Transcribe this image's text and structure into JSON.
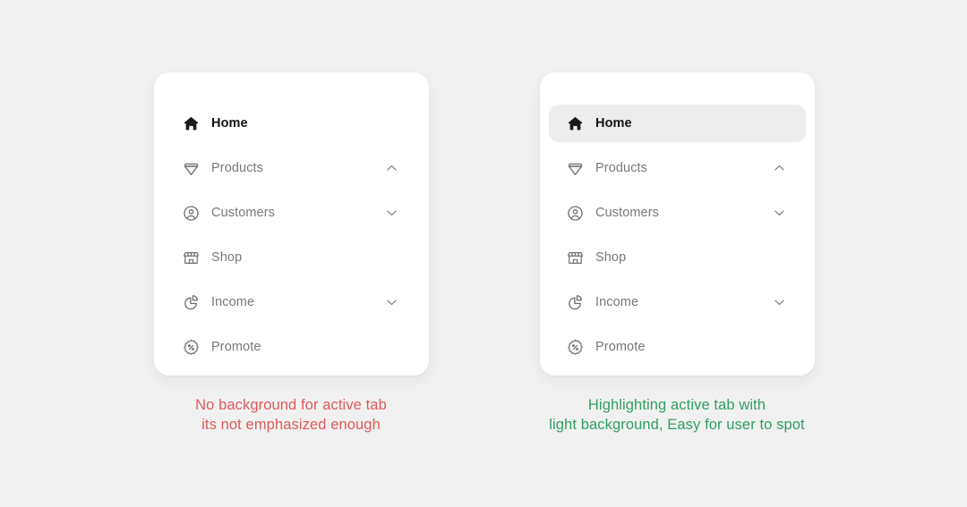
{
  "page": {
    "background_color": "#f1f1f1",
    "title": "Active tab highlight UI comparison"
  },
  "colors": {
    "card_background": "#ffffff",
    "active_highlight": "#ededee",
    "label_inactive": "#75787b",
    "label_active": "#111315",
    "caption_bad": "#e05a5a",
    "caption_good": "#2f9e63"
  },
  "panels": [
    {
      "id": "bad-example",
      "active_item": "Home",
      "active_has_background": false,
      "items": [
        {
          "label": "Home",
          "icon": "home-icon",
          "active": true,
          "chevron": "none"
        },
        {
          "label": "Products",
          "icon": "diamond-icon",
          "active": false,
          "chevron": "up"
        },
        {
          "label": "Customers",
          "icon": "user-circle-icon",
          "active": false,
          "chevron": "down"
        },
        {
          "label": "Shop",
          "icon": "storefront-icon",
          "active": false,
          "chevron": "none"
        },
        {
          "label": "Income",
          "icon": "pie-chart-icon",
          "active": false,
          "chevron": "down"
        },
        {
          "label": "Promote",
          "icon": "percent-badge-icon",
          "active": false,
          "chevron": "none"
        }
      ],
      "caption": {
        "line1": "No background for active tab",
        "line2": "its not emphasized enough"
      }
    },
    {
      "id": "good-example",
      "active_item": "Home",
      "active_has_background": true,
      "items": [
        {
          "label": "Home",
          "icon": "home-icon",
          "active": true,
          "chevron": "none"
        },
        {
          "label": "Products",
          "icon": "diamond-icon",
          "active": false,
          "chevron": "up"
        },
        {
          "label": "Customers",
          "icon": "user-circle-icon",
          "active": false,
          "chevron": "down"
        },
        {
          "label": "Shop",
          "icon": "storefront-icon",
          "active": false,
          "chevron": "none"
        },
        {
          "label": "Income",
          "icon": "pie-chart-icon",
          "active": false,
          "chevron": "down"
        },
        {
          "label": "Promote",
          "icon": "percent-badge-icon",
          "active": false,
          "chevron": "none"
        }
      ],
      "caption": {
        "line1": "Highlighting active tab with",
        "line2": "light background, Easy for user to spot"
      }
    }
  ]
}
